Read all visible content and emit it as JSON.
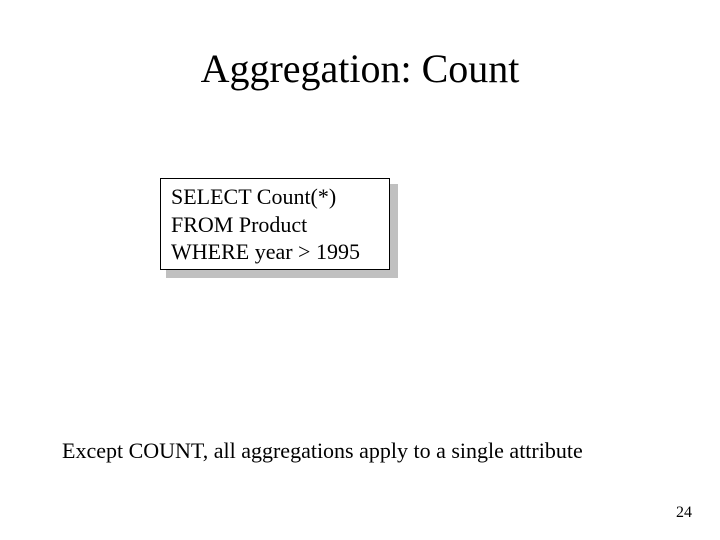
{
  "title": "Aggregation: Count",
  "code": {
    "line1_kw": "SELECT",
    "line1_rest": "  Count(*)",
    "line2_kw": "FROM",
    "line2_rest": "     Product",
    "line3_kw": "WHERE",
    "line3_rest": "  year > 1995"
  },
  "note": "Except COUNT, all aggregations apply to a single attribute",
  "page_number": "24"
}
